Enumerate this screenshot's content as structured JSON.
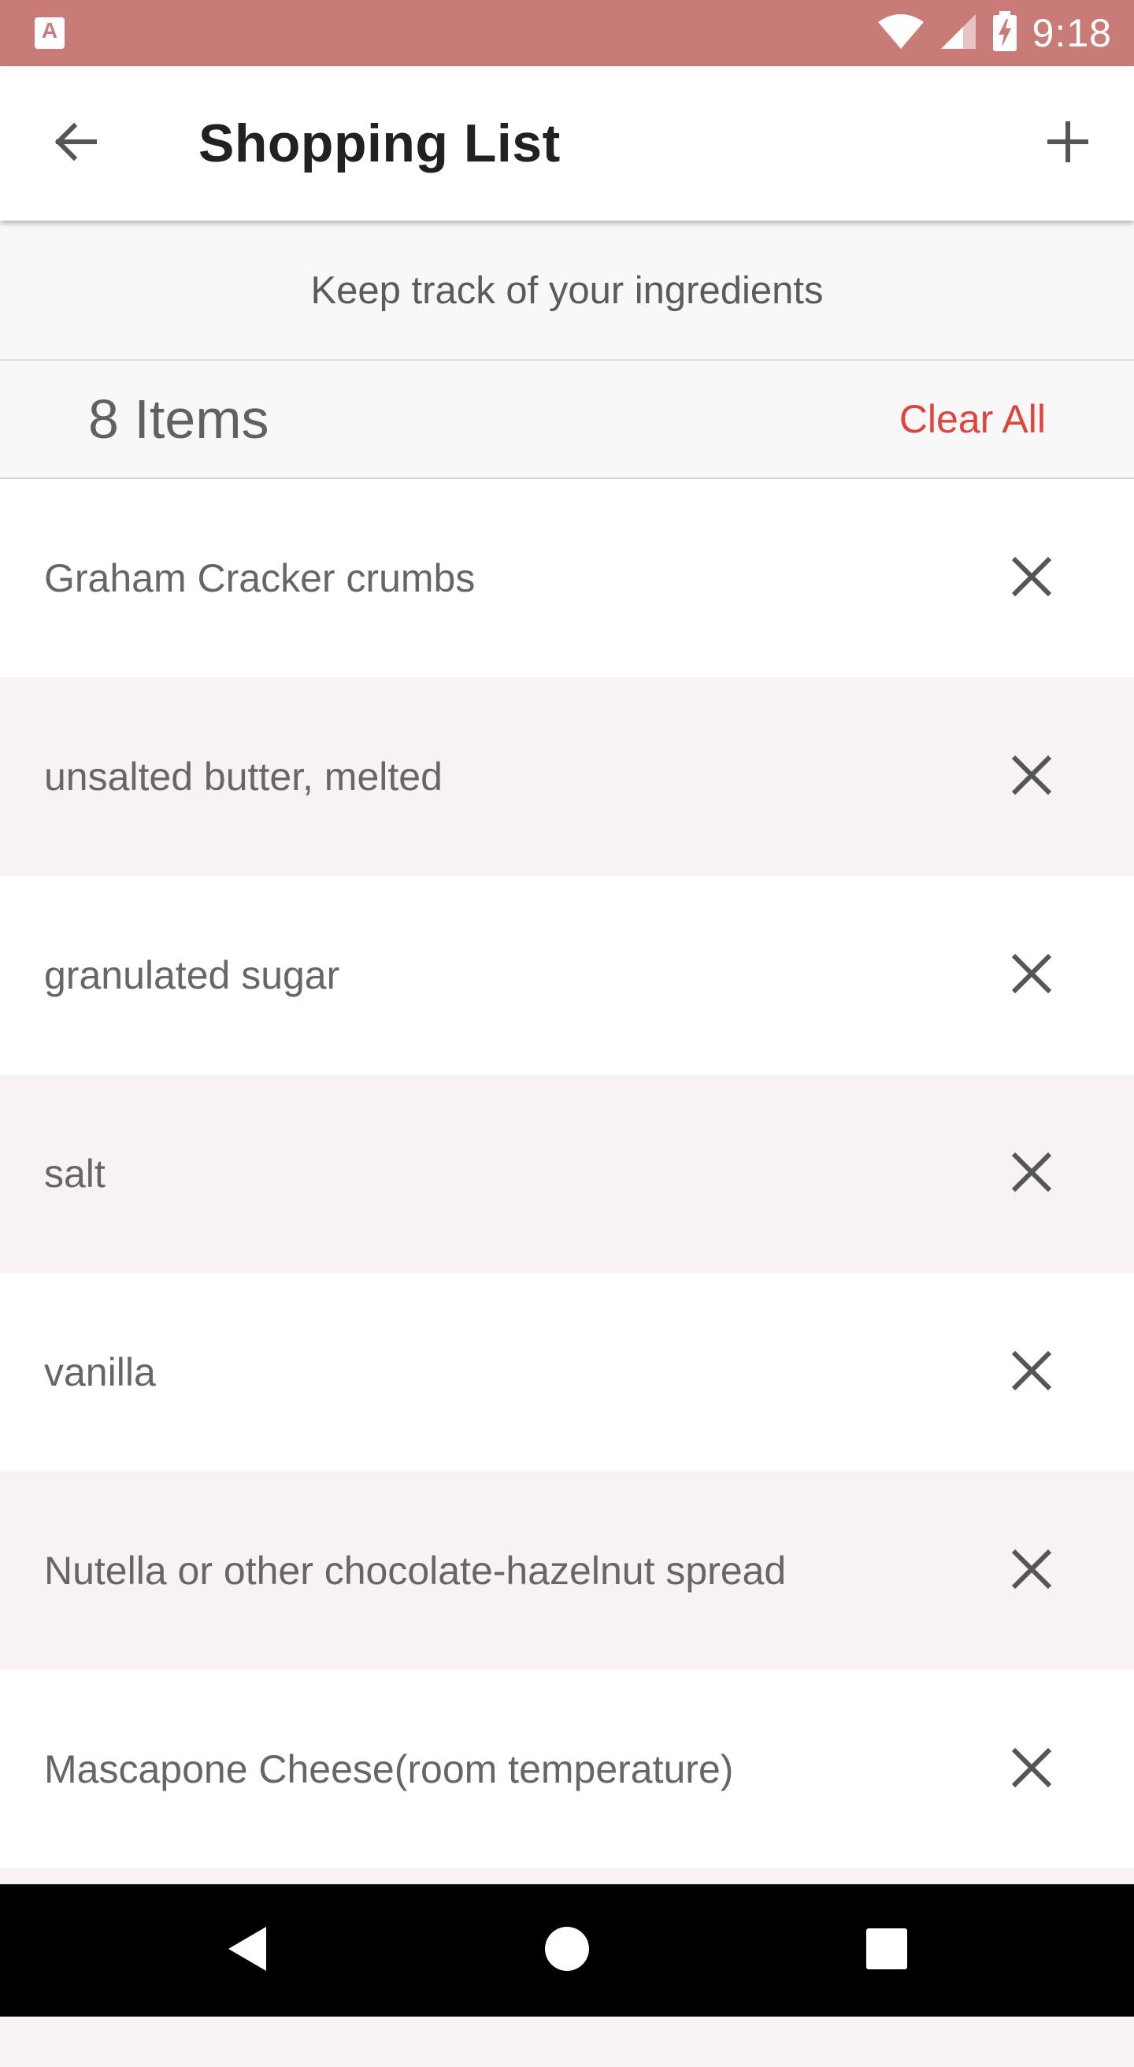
{
  "status_bar": {
    "time": "9:18",
    "app_icon_letter": "A",
    "color": "#c97b77"
  },
  "app_bar": {
    "title": "Shopping List",
    "back_icon": "arrow-back-icon",
    "add_icon": "plus-icon"
  },
  "subtitle": "Keep track of your ingredients",
  "summary": {
    "count_label": "8 Items",
    "clear_label": "Clear All",
    "clear_color": "#e1433a"
  },
  "items": [
    {
      "label": "Graham Cracker crumbs"
    },
    {
      "label": "unsalted butter, melted"
    },
    {
      "label": "granulated sugar"
    },
    {
      "label": "salt"
    },
    {
      "label": "vanilla"
    },
    {
      "label": "Nutella or other chocolate-hazelnut spread"
    },
    {
      "label": "Mascapone Cheese(room temperature)"
    }
  ],
  "nav_bar": {
    "icons": [
      "back-triangle-icon",
      "home-circle-icon",
      "recents-square-icon"
    ]
  }
}
